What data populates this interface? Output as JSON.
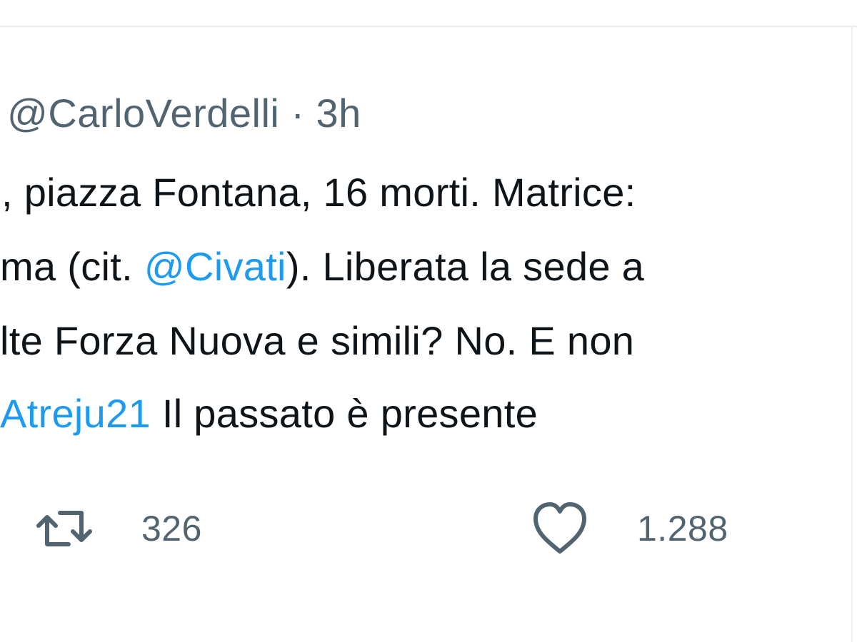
{
  "tweet": {
    "handle": "@CarloVerdelli",
    "separator": "·",
    "time": "3h",
    "lines": [
      [
        {
          "text": ", piazza Fontana, 16 morti. Matrice:",
          "kind": "text"
        }
      ],
      [
        {
          "text": " ma (cit. ",
          "kind": "text"
        },
        {
          "text": "@Civati",
          "kind": "mention"
        },
        {
          "text": "). Liberata la sede a",
          "kind": "text"
        }
      ],
      [
        {
          "text": "lte Forza Nuova e simili? No. E non",
          "kind": "text"
        }
      ],
      [
        {
          "text": "Atreju21",
          "kind": "hashtag"
        },
        {
          "text": " Il passato è presente",
          "kind": "text"
        }
      ]
    ]
  },
  "actions": {
    "retweets": {
      "icon": "retweet-icon",
      "count": "326"
    },
    "likes": {
      "icon": "heart-icon",
      "count": "1.288"
    }
  },
  "colors": {
    "text": "#0f1419",
    "muted": "#536471",
    "link": "#1d9bf0",
    "border": "#e6ecf0"
  }
}
